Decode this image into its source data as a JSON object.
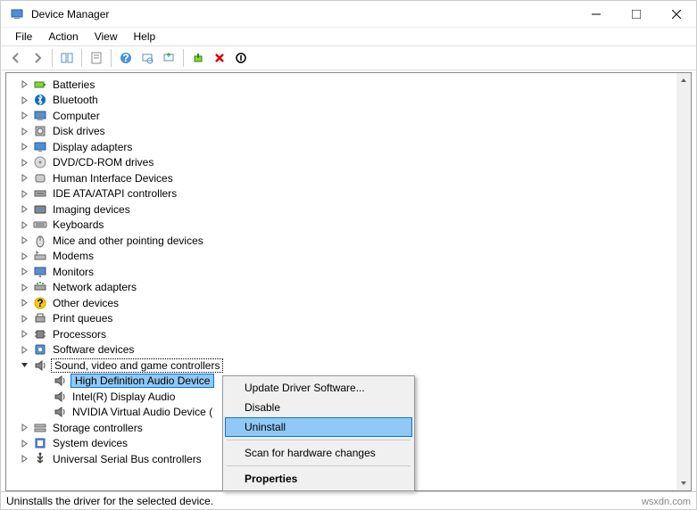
{
  "window": {
    "title": "Device Manager"
  },
  "menu": {
    "file": "File",
    "action": "Action",
    "view": "View",
    "help": "Help"
  },
  "tree": [
    {
      "label": "Batteries",
      "expanded": false,
      "icon": "battery",
      "depth": 1
    },
    {
      "label": "Bluetooth",
      "expanded": false,
      "icon": "bluetooth",
      "depth": 1
    },
    {
      "label": "Computer",
      "expanded": false,
      "icon": "computer",
      "depth": 1
    },
    {
      "label": "Disk drives",
      "expanded": false,
      "icon": "disk",
      "depth": 1
    },
    {
      "label": "Display adapters",
      "expanded": false,
      "icon": "display",
      "depth": 1
    },
    {
      "label": "DVD/CD-ROM drives",
      "expanded": false,
      "icon": "cdrom",
      "depth": 1
    },
    {
      "label": "Human Interface Devices",
      "expanded": false,
      "icon": "hid",
      "depth": 1
    },
    {
      "label": "IDE ATA/ATAPI controllers",
      "expanded": false,
      "icon": "ide",
      "depth": 1
    },
    {
      "label": "Imaging devices",
      "expanded": false,
      "icon": "imaging",
      "depth": 1
    },
    {
      "label": "Keyboards",
      "expanded": false,
      "icon": "keyboard",
      "depth": 1
    },
    {
      "label": "Mice and other pointing devices",
      "expanded": false,
      "icon": "mouse",
      "depth": 1
    },
    {
      "label": "Modems",
      "expanded": false,
      "icon": "modem",
      "depth": 1
    },
    {
      "label": "Monitors",
      "expanded": false,
      "icon": "monitor",
      "depth": 1
    },
    {
      "label": "Network adapters",
      "expanded": false,
      "icon": "network",
      "depth": 1
    },
    {
      "label": "Other devices",
      "expanded": false,
      "icon": "other",
      "depth": 1
    },
    {
      "label": "Print queues",
      "expanded": false,
      "icon": "printer",
      "depth": 1
    },
    {
      "label": "Processors",
      "expanded": false,
      "icon": "cpu",
      "depth": 1
    },
    {
      "label": "Software devices",
      "expanded": false,
      "icon": "software",
      "depth": 1
    },
    {
      "label": "Sound, video and game controllers",
      "expanded": true,
      "icon": "sound",
      "depth": 1,
      "selected_parent": true
    },
    {
      "label": "High Definition Audio Device",
      "expanded": null,
      "icon": "speaker",
      "depth": 2,
      "selected_child": true
    },
    {
      "label": "Intel(R) Display Audio",
      "expanded": null,
      "icon": "speaker",
      "depth": 2
    },
    {
      "label": "NVIDIA Virtual Audio Device (",
      "expanded": null,
      "icon": "speaker",
      "depth": 2
    },
    {
      "label": "Storage controllers",
      "expanded": false,
      "icon": "storage",
      "depth": 1
    },
    {
      "label": "System devices",
      "expanded": false,
      "icon": "system",
      "depth": 1
    },
    {
      "label": "Universal Serial Bus controllers",
      "expanded": false,
      "icon": "usb",
      "depth": 1
    }
  ],
  "context_menu": {
    "update": "Update Driver Software...",
    "disable": "Disable",
    "uninstall": "Uninstall",
    "scan": "Scan for hardware changes",
    "properties": "Properties"
  },
  "status": {
    "text": "Uninstalls the driver for the selected device."
  },
  "watermark": "wsxdn.com"
}
